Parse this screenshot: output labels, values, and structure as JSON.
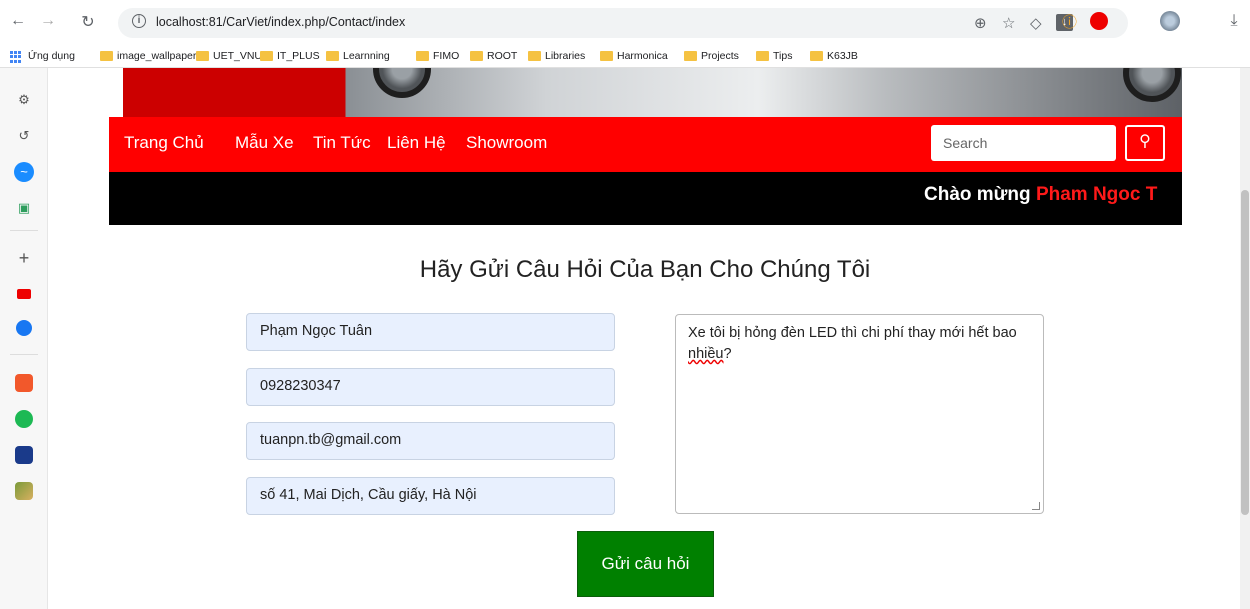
{
  "browser": {
    "url": "localhost:81/CarViet/index.php/Contact/index",
    "bookmarks": [
      "Ứng dụng",
      "image_wallpaper",
      "UET_VNU",
      "IT_PLUS",
      "Learnning",
      "FIMO",
      "ROOT",
      "Libraries",
      "Harmonica",
      "Projects",
      "Tips",
      "K63JB"
    ]
  },
  "nav": {
    "items": [
      "Trang Chủ",
      "Mẫu Xe",
      "Tin Tức",
      "Liên Hệ",
      "Showroom"
    ],
    "search_placeholder": "Search"
  },
  "ticker": {
    "greeting": "Chào mừng",
    "user": "Pham Ngoc T"
  },
  "form": {
    "title": "Hãy Gửi Câu Hỏi Của Bạn Cho Chúng Tôi",
    "name": "Phạm Ngọc Tuân",
    "phone": "0928230347",
    "email": "tuanpn.tb@gmail.com",
    "address": "số 41, Mai Dịch, Cầu giấy, Hà Nội",
    "message_part1": "Xe tôi bị hỏng đèn LED thì chi phí thay mới hết bao",
    "message_part2": "nhiều",
    "message_part3": "?",
    "submit_label": "Gửi câu hỏi"
  },
  "colors": {
    "brand_red": "#ff0000",
    "submit_green": "#008000",
    "ticker_bg": "#000000"
  }
}
